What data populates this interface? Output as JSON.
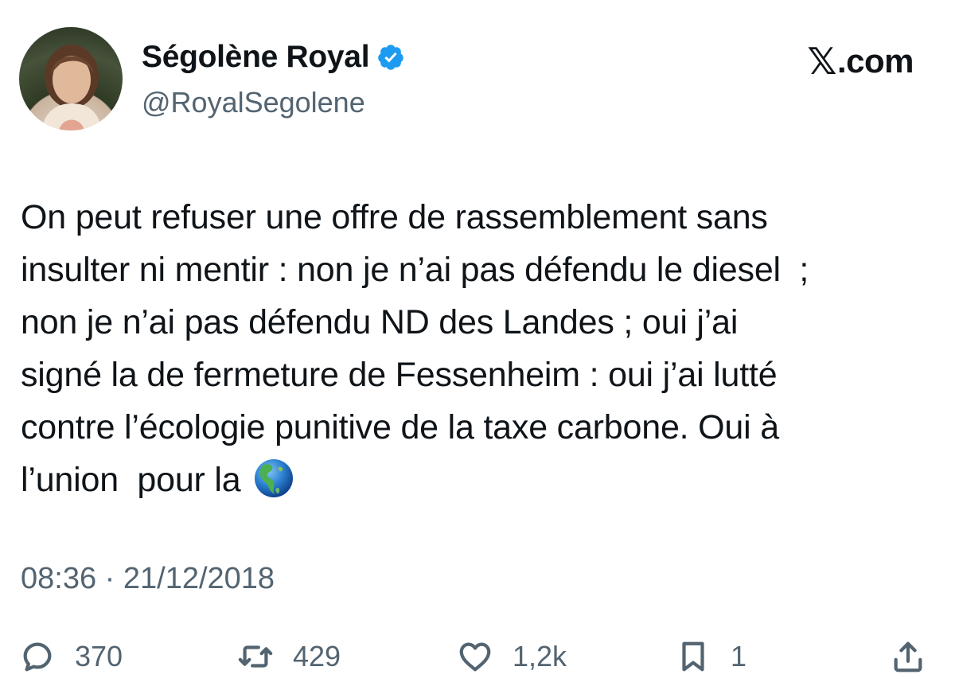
{
  "author": {
    "display_name": "Ségolène Royal",
    "handle": "@RoyalSegolene",
    "verified": true
  },
  "brand": {
    "label": ".com",
    "logo_icon": "x-logo-icon"
  },
  "tweet": {
    "text": "On peut refuser une offre de rassemblement sans\ninsulter ni mentir : non je n’ai pas défendu le diesel  ;\nnon je n’ai pas défendu ND des Landes ; oui j’ai\nsigné la de fermeture de Fessenheim : oui j’ai lutté\ncontre l’écologie punitive de la taxe carbone. Oui à\nl’union  pour la ",
    "trailing_emoji": "globe-americas-icon",
    "timestamp": "08:36 · 21/12/2018"
  },
  "actions": {
    "replies": "370",
    "reposts": "429",
    "likes": "1,2k",
    "bookmarks": "1"
  },
  "colors": {
    "text": "#0f1419",
    "secondary": "#536471",
    "verified": "#1d9bf0"
  }
}
